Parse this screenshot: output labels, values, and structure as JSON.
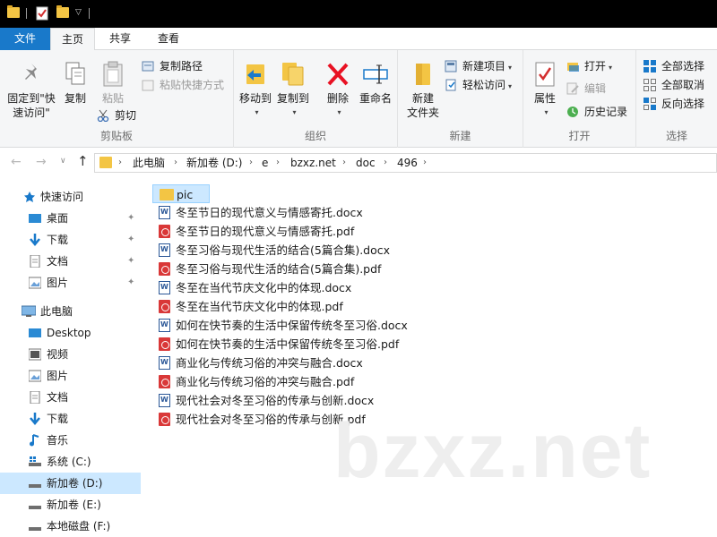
{
  "menu": {
    "file": "文件",
    "home": "主页",
    "share": "共享",
    "view": "查看"
  },
  "ribbon": {
    "clipboard": {
      "label": "剪贴板",
      "pin_line1": "固定到\"快",
      "pin_line2": "速访问\"",
      "copy": "复制",
      "paste": "粘贴",
      "copy_path": "复制路径",
      "paste_shortcut": "粘贴快捷方式",
      "cut": "剪切"
    },
    "organize": {
      "label": "组织",
      "move_to": "移动到",
      "copy_to": "复制到",
      "delete": "删除",
      "rename": "重命名"
    },
    "new": {
      "label": "新建",
      "new_folder_line1": "新建",
      "new_folder_line2": "文件夹",
      "new_item": "新建项目",
      "easy_access": "轻松访问"
    },
    "open": {
      "label": "打开",
      "properties": "属性",
      "open": "打开",
      "edit": "编辑",
      "history": "历史记录"
    },
    "select": {
      "label": "选择",
      "select_all": "全部选择",
      "select_none": "全部取消",
      "invert": "反向选择"
    }
  },
  "address": {
    "crumbs": [
      "此电脑",
      "新加卷 (D:)",
      "e",
      "bzxz.net",
      "doc",
      "496"
    ]
  },
  "nav": {
    "quick_access": "快速访问",
    "desktop_cn": "桌面",
    "downloads_cn": "下载",
    "documents_cn": "文档",
    "pictures_cn": "图片",
    "this_pc": "此电脑",
    "desktop": "Desktop",
    "videos": "视频",
    "pictures": "图片",
    "documents": "文档",
    "downloads": "下载",
    "music": "音乐",
    "drive_c": "系统 (C:)",
    "drive_d": "新加卷 (D:)",
    "drive_e": "新加卷 (E:)",
    "drive_f": "本地磁盘 (F:)"
  },
  "files": [
    {
      "name": "pic",
      "type": "folder"
    },
    {
      "name": "冬至节日的现代意义与情感寄托.docx",
      "type": "docx"
    },
    {
      "name": "冬至节日的现代意义与情感寄托.pdf",
      "type": "pdf"
    },
    {
      "name": "冬至习俗与现代生活的结合(5篇合集).docx",
      "type": "docx"
    },
    {
      "name": "冬至习俗与现代生活的结合(5篇合集).pdf",
      "type": "pdf"
    },
    {
      "name": "冬至在当代节庆文化中的体现.docx",
      "type": "docx"
    },
    {
      "name": "冬至在当代节庆文化中的体现.pdf",
      "type": "pdf"
    },
    {
      "name": "如何在快节奏的生活中保留传统冬至习俗.docx",
      "type": "docx"
    },
    {
      "name": "如何在快节奏的生活中保留传统冬至习俗.pdf",
      "type": "pdf"
    },
    {
      "name": "商业化与传统习俗的冲突与融合.docx",
      "type": "docx"
    },
    {
      "name": "商业化与传统习俗的冲突与融合.pdf",
      "type": "pdf"
    },
    {
      "name": "现代社会对冬至习俗的传承与创新.docx",
      "type": "docx"
    },
    {
      "name": "现代社会对冬至习俗的传承与创新.pdf",
      "type": "pdf"
    }
  ],
  "watermark": "bzxz.net",
  "colors": {
    "accent": "#1979ca",
    "selection": "#cce8ff",
    "folder": "#f3c544",
    "delete_red": "#e81123"
  }
}
